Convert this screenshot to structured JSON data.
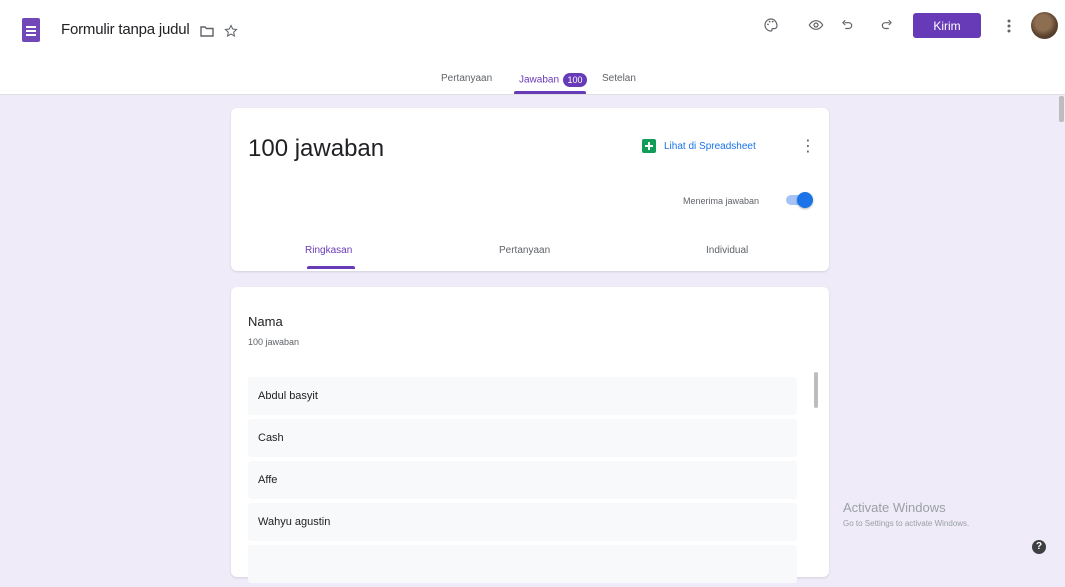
{
  "header": {
    "doc_title": "Formulir tanpa judul",
    "send_label": "Kirim",
    "tabs": [
      {
        "label": "Pertanyaan"
      },
      {
        "label": "Jawaban",
        "badge": "100"
      },
      {
        "label": "Setelan"
      }
    ],
    "active_tab": "Jawaban"
  },
  "summary": {
    "title": "100 jawaban",
    "sheet_link": "Lihat di Spreadsheet",
    "accepting_label": "Menerima jawaban",
    "accepting_on": true,
    "subtabs": [
      "Ringkasan",
      "Pertanyaan",
      "Individual"
    ],
    "active_subtab": "Ringkasan"
  },
  "question": {
    "title": "Nama",
    "count": "100 jawaban",
    "answers": [
      "Abdul basyit",
      "Cash",
      "Affe",
      "Wahyu agustin",
      ""
    ]
  },
  "windows_watermark": {
    "line1": "Activate Windows",
    "line2": "Go to Settings to activate Windows."
  },
  "colors": {
    "brand": "#673ab7",
    "background": "#f0ebf8",
    "link": "#1a73e8",
    "sheets_green": "#0f9d58"
  },
  "icons": [
    "forms-logo-icon",
    "folder-icon",
    "star-icon",
    "palette-icon",
    "preview-eye-icon",
    "undo-icon",
    "redo-icon",
    "more-vert-icon",
    "sheets-icon",
    "help-icon"
  ]
}
